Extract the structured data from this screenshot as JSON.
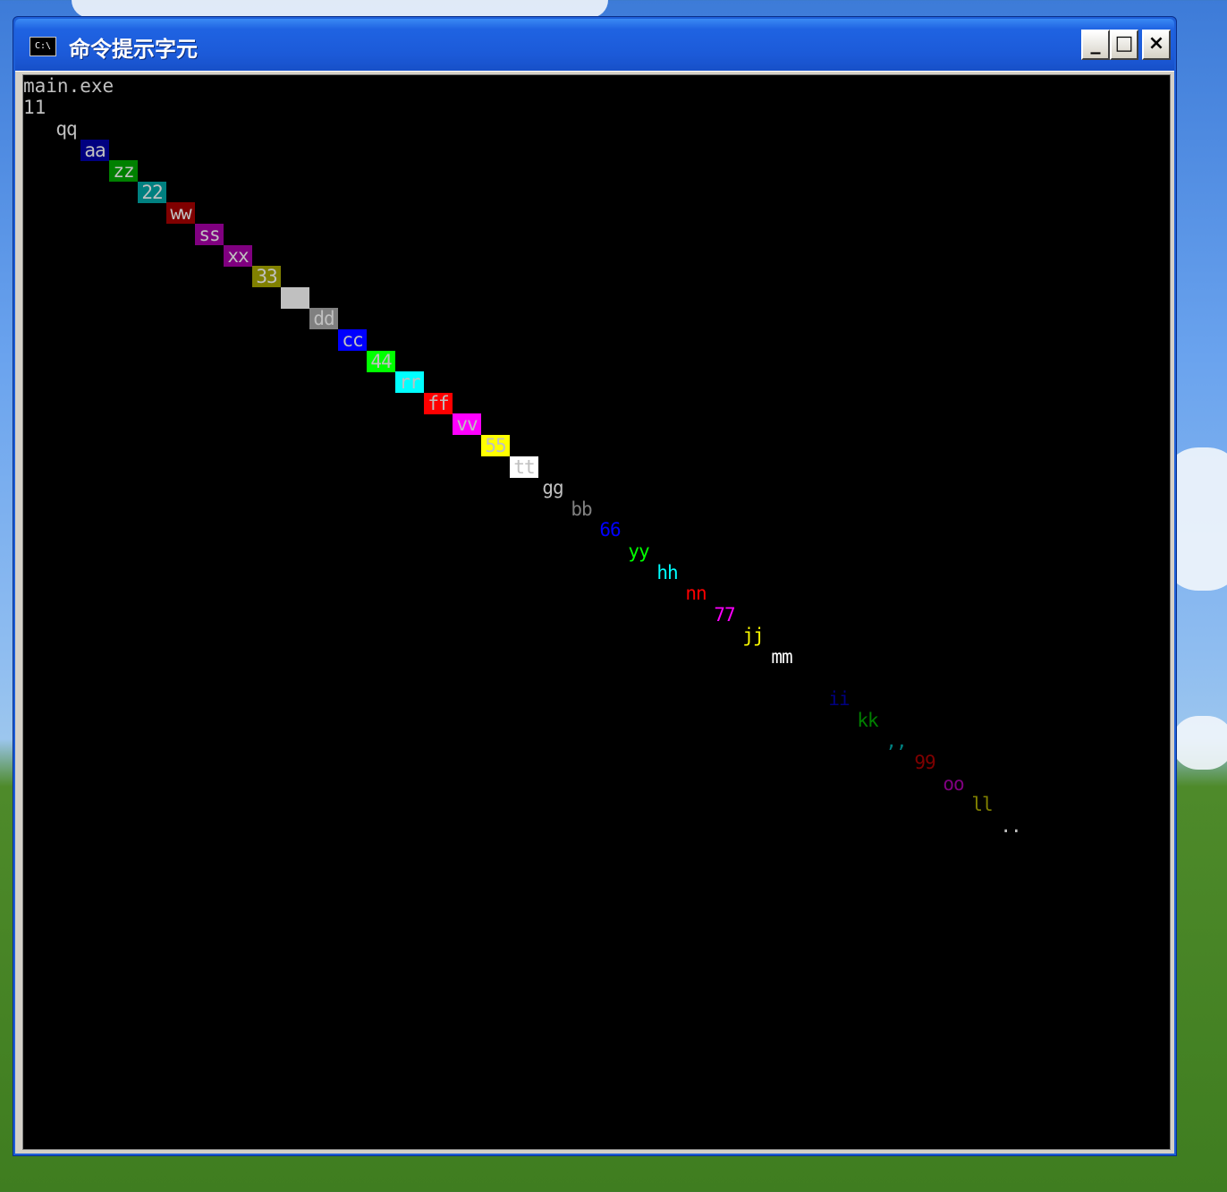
{
  "window": {
    "title": "命令提示字元",
    "icon_label": "C:\\",
    "buttons": {
      "minimize": "_",
      "maximize": "□",
      "close": "×"
    }
  },
  "console": {
    "lines": [
      "main.exe",
      "11"
    ],
    "colored_items": [
      {
        "text": "qq",
        "fg": "#c0c0c0",
        "bg": "#000000"
      },
      {
        "text": "aa",
        "fg": "#c0c0c0",
        "bg": "#000080"
      },
      {
        "text": "zz",
        "fg": "#c0c0c0",
        "bg": "#008000"
      },
      {
        "text": "22",
        "fg": "#c0c0c0",
        "bg": "#008080"
      },
      {
        "text": "ww",
        "fg": "#c0c0c0",
        "bg": "#800000"
      },
      {
        "text": "ss",
        "fg": "#c0c0c0",
        "bg": "#800080"
      },
      {
        "text": "xx",
        "fg": "#c0c0c0",
        "bg": "#800080"
      },
      {
        "text": "33",
        "fg": "#c0c0c0",
        "bg": "#808000"
      },
      {
        "text": "",
        "fg": "#c0c0c0",
        "bg": "#c0c0c0"
      },
      {
        "text": "dd",
        "fg": "#c0c0c0",
        "bg": "#808080"
      },
      {
        "text": "cc",
        "fg": "#c0c0c0",
        "bg": "#0000ff"
      },
      {
        "text": "44",
        "fg": "#c0c0c0",
        "bg": "#00ff00"
      },
      {
        "text": "rr",
        "fg": "#c0c0c0",
        "bg": "#00ffff"
      },
      {
        "text": "ff",
        "fg": "#c0c0c0",
        "bg": "#ff0000"
      },
      {
        "text": "vv",
        "fg": "#c0c0c0",
        "bg": "#ff00ff"
      },
      {
        "text": "55",
        "fg": "#c0c0c0",
        "bg": "#ffff00"
      },
      {
        "text": "tt",
        "fg": "#c0c0c0",
        "bg": "#ffffff"
      },
      {
        "text": "gg",
        "fg": "#c0c0c0",
        "bg": "#000000"
      },
      {
        "text": "bb",
        "fg": "#808080",
        "bg": "#000000"
      },
      {
        "text": "66",
        "fg": "#0000ff",
        "bg": "#000000"
      },
      {
        "text": "yy",
        "fg": "#00ff00",
        "bg": "#000000"
      },
      {
        "text": "hh",
        "fg": "#00ffff",
        "bg": "#000000"
      },
      {
        "text": "nn",
        "fg": "#ff0000",
        "bg": "#000000"
      },
      {
        "text": "77",
        "fg": "#ff00ff",
        "bg": "#000000"
      },
      {
        "text": "jj",
        "fg": "#ffff00",
        "bg": "#000000"
      },
      {
        "text": "mm",
        "fg": "#ffffff",
        "bg": "#000000"
      },
      {
        "text": "",
        "fg": "#000000",
        "bg": "#000000"
      },
      {
        "text": "ii",
        "fg": "#000080",
        "bg": "#000000"
      },
      {
        "text": "kk",
        "fg": "#008000",
        "bg": "#000000"
      },
      {
        "text": ",,",
        "fg": "#008080",
        "bg": "#000000"
      },
      {
        "text": "99",
        "fg": "#800000",
        "bg": "#000000"
      },
      {
        "text": "oo",
        "fg": "#800080",
        "bg": "#000000"
      },
      {
        "text": "ll",
        "fg": "#808000",
        "bg": "#000000"
      },
      {
        "text": "..",
        "fg": "#c0c0c0",
        "bg": "#000000"
      }
    ]
  }
}
